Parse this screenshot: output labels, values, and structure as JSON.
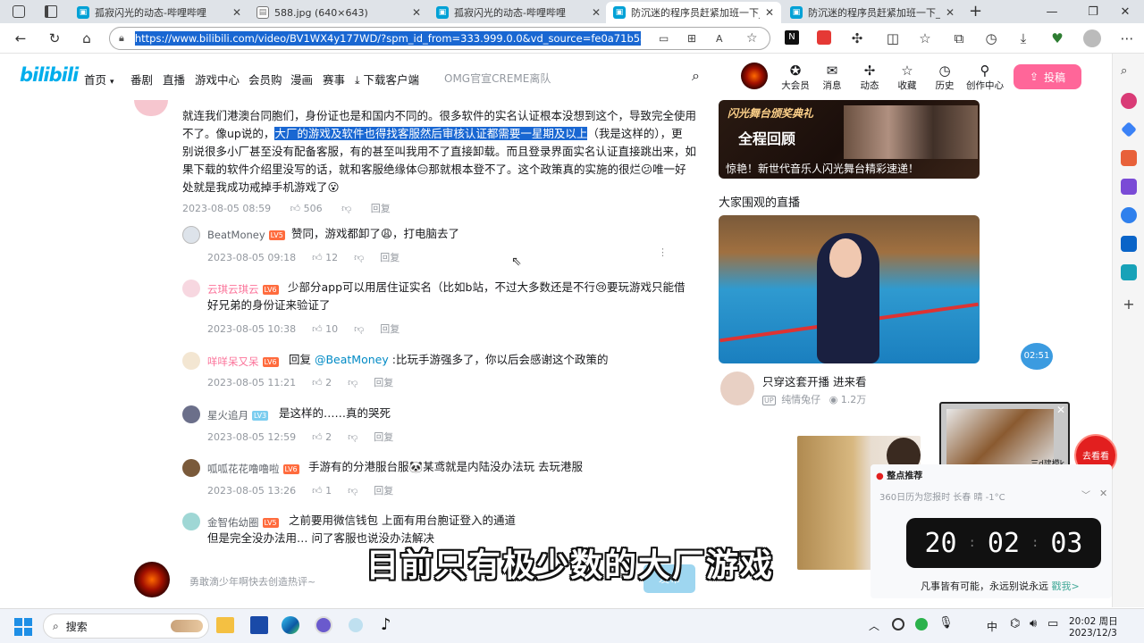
{
  "browser": {
    "tabs": [
      {
        "title": "孤寂闪光的动态-哔哩哔哩",
        "icon": "bilibili-icon"
      },
      {
        "title": "588.jpg (640×643)",
        "icon": "file-icon"
      },
      {
        "title": "孤寂闪光的动态-哔哩哔哩",
        "icon": "bilibili-icon"
      },
      {
        "title": "防沉迷的程序员赶紧加班一下_哔哩",
        "icon": "bilibili-icon"
      },
      {
        "title": "防沉迷的程序员赶紧加班一下_哔哩",
        "icon": "bilibili-icon"
      }
    ],
    "url": "https://www.bilibili.com/video/BV1WX4y177WD/?spm_id_from=333.999.0.0&vd_source=fe0a71b58dbbe2e4e6"
  },
  "header": {
    "logo": "bilibili",
    "nav": [
      "首页",
      "番剧",
      "直播",
      "游戏中心",
      "会员购",
      "漫画",
      "赛事",
      "下载客户端"
    ],
    "search_placeholder": "OMG官宣CREME离队",
    "icons": [
      "大会员",
      "消息",
      "动态",
      "收藏",
      "历史",
      "创作中心"
    ],
    "upload": "投稿"
  },
  "comments": {
    "main": {
      "line1": "就连我们港澳台同胞们，身份证也是和国内不同的。很多软件的实名认证根本没想到这个，导致完全使用",
      "line2_pre": "不了。像up说的，",
      "line2_hl": "大厂的游戏及软件也得找客服然后审核认证都需要一星期及以上",
      "line2_post": "（我是这样的），更",
      "line3": "别说很多小厂甚至没有配备客服，有的甚至叫我用不了直接卸载。而且登录界面实名认证直接跳出来，如",
      "line4": "果下载的软件介绍里没写的话，就和客服绝缘体😑那就根本登不了。这个政策真的实施的很烂😕唯一好",
      "line5": "处就是我成功戒掉手机游戏了😮",
      "time": "2023-08-05 08:59",
      "likes": "506",
      "reply": "回复"
    },
    "replies": [
      {
        "user": "BeatMoney",
        "level": "LV5",
        "text": "赞同，游戏都卸了😩，打电脑去了",
        "time": "2023-08-05 09:18",
        "likes": "12",
        "reply": "回复"
      },
      {
        "user": "云琪云琪云",
        "level": "LV6",
        "text": "少部分app可以用居住证实名（比如b站，不过大多数还是不行😢要玩游戏只能借",
        "text2": "好兄弟的身份证来验证了",
        "time": "2023-08-05 10:38",
        "likes": "10",
        "reply": "回复"
      },
      {
        "user": "咩咩呆又呆",
        "level": "LV6",
        "text_pre": "回复 ",
        "text_at": "@BeatMoney",
        "text": " :比玩手游强多了，你以后会感谢这个政策的",
        "time": "2023-08-05 11:21",
        "likes": "2",
        "reply": "回复"
      },
      {
        "user": "星火追月",
        "level": "LV3",
        "text": "是这样的……真的哭死",
        "time": "2023-08-05 12:59",
        "likes": "2",
        "reply": "回复"
      },
      {
        "user": "呱呱花花噜噜啦",
        "level": "LV6",
        "text": "手游有的分港服台服🐼某鸢就是内陆没办法玩 去玩港服",
        "time": "2023-08-05 13:26",
        "likes": "1",
        "reply": "回复"
      },
      {
        "user": "金智佑幼圈",
        "level": "LV5",
        "text": "之前要用微信钱包 上面有用台胞证登入的通道",
        "text2": "但是完全没办法用… 问了客服也说没办法解决"
      }
    ],
    "input_placeholder": "勇敢滴少年啊快去创造热评~",
    "send": "发布"
  },
  "right": {
    "banner_title": "闪光舞台颁奖典礼",
    "banner_sub": "全程回顾",
    "banner_caption": "惊艳！新世代音乐人闪光舞台精彩速递！",
    "live_heading": "大家围观的直播",
    "live_title": "只穿这套开播 进来看",
    "live_user": "纯情兔仔",
    "live_views": "1.2万",
    "timer_badge": "02:51",
    "mini_label": "三d建模k",
    "goto": "去看看",
    "popup_tag": "整点推荐",
    "weather": "360日历为您报时 长春 晴 -1°C",
    "clock": [
      "20",
      "02",
      "03"
    ],
    "slogan": "凡事皆有可能，永远别说永远",
    "slogan_link": "戳我>"
  },
  "subtitle": "目前只有极少数的大厂游戏",
  "taskbar": {
    "search": "搜索",
    "time": "20:02 周日",
    "date": "2023/12/3",
    "ime": "中"
  }
}
